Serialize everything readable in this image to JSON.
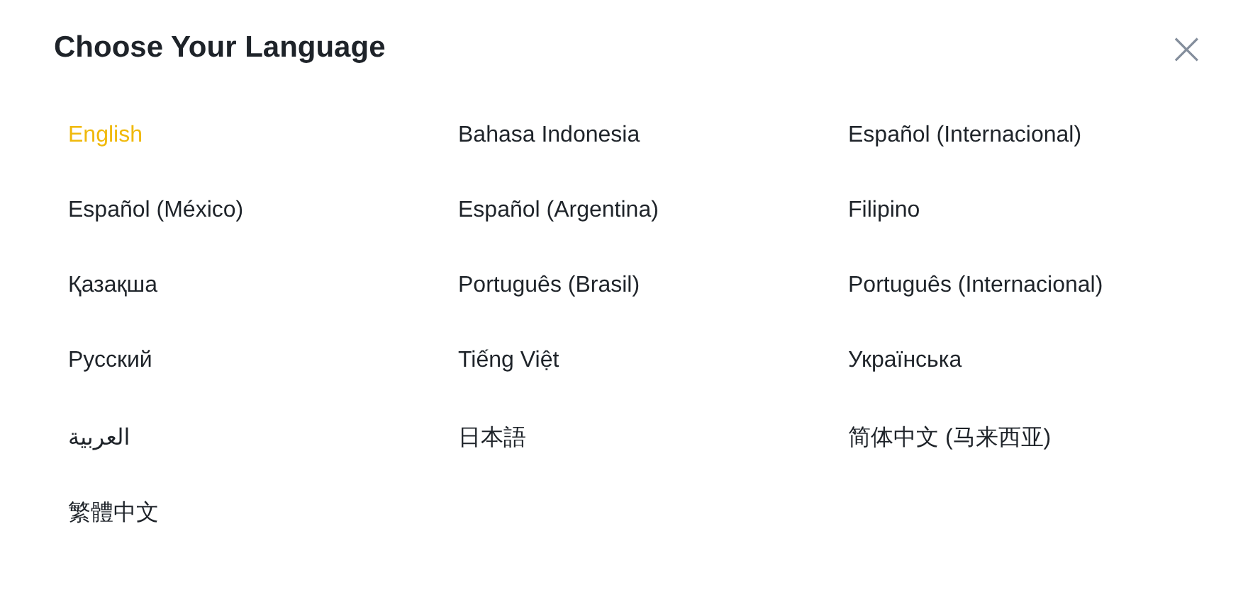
{
  "dialog": {
    "title": "Choose Your Language",
    "close": "×"
  },
  "languages": [
    {
      "label": "English",
      "selected": true
    },
    {
      "label": "Bahasa Indonesia",
      "selected": false
    },
    {
      "label": "Español (Internacional)",
      "selected": false
    },
    {
      "label": "Español (México)",
      "selected": false
    },
    {
      "label": "Español (Argentina)",
      "selected": false
    },
    {
      "label": "Filipino",
      "selected": false
    },
    {
      "label": "Қазақша",
      "selected": false
    },
    {
      "label": "Português (Brasil)",
      "selected": false
    },
    {
      "label": "Português (Internacional)",
      "selected": false
    },
    {
      "label": "Русский",
      "selected": false
    },
    {
      "label": "Tiếng Việt",
      "selected": false
    },
    {
      "label": "Українська",
      "selected": false
    },
    {
      "label": "العربية",
      "selected": false
    },
    {
      "label": "日本語",
      "selected": false
    },
    {
      "label": "简体中文 (马来西亚)",
      "selected": false
    },
    {
      "label": "繁體中文",
      "selected": false
    }
  ]
}
